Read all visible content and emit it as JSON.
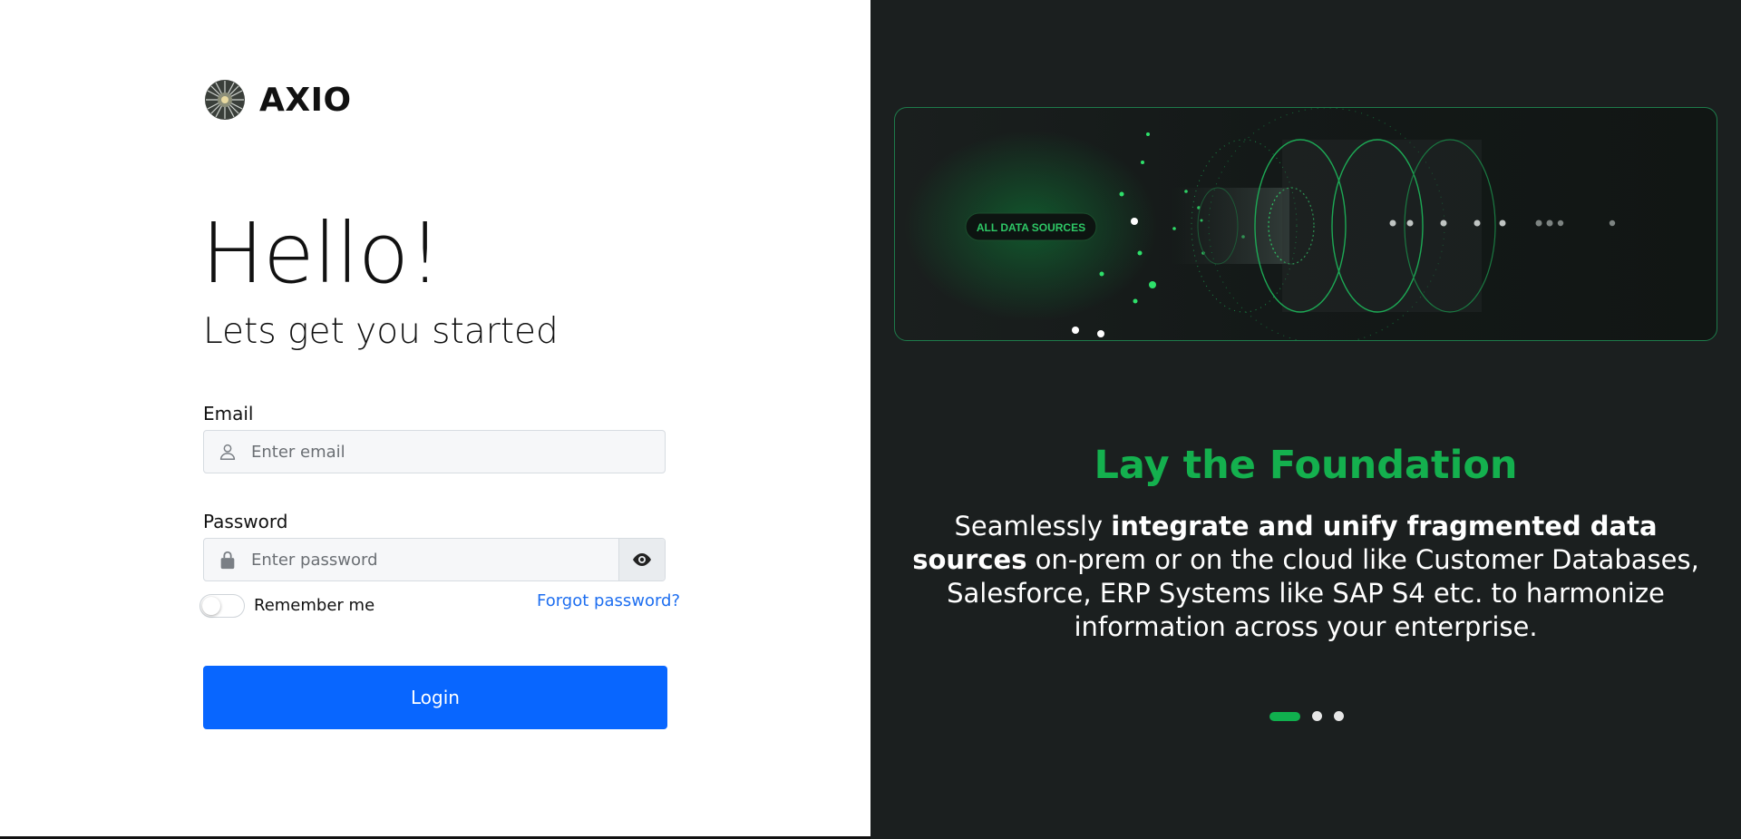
{
  "brand": {
    "name": "AXIO"
  },
  "greeting": {
    "title": "Hello!",
    "subtitle": "Lets get you started"
  },
  "form": {
    "email_label": "Email",
    "email_placeholder": "Enter email",
    "password_label": "Password",
    "password_placeholder": "Enter password",
    "remember_label": "Remember me",
    "forgot_label": "Forgot password?",
    "login_label": "Login"
  },
  "carousel": {
    "hero_badge": "ALL DATA SOURCES",
    "title": "Lay the Foundation",
    "description": {
      "before": "Seamlessly ",
      "bold": "integrate and unify fragmented data sources",
      "after": " on-prem or on the cloud like Customer Databases, Salesforce, ERP Systems like SAP S4 etc. to harmonize information across your enterprise."
    },
    "slide_count": 3,
    "active_slide": 1
  },
  "colors": {
    "accent_green": "#14b04e",
    "primary_blue": "#0866ff",
    "link_blue": "#1d6ef0",
    "dark_panel": "#1b1f1f"
  },
  "icons": [
    "logo-icon",
    "user-icon",
    "lock-icon",
    "eye-icon"
  ]
}
